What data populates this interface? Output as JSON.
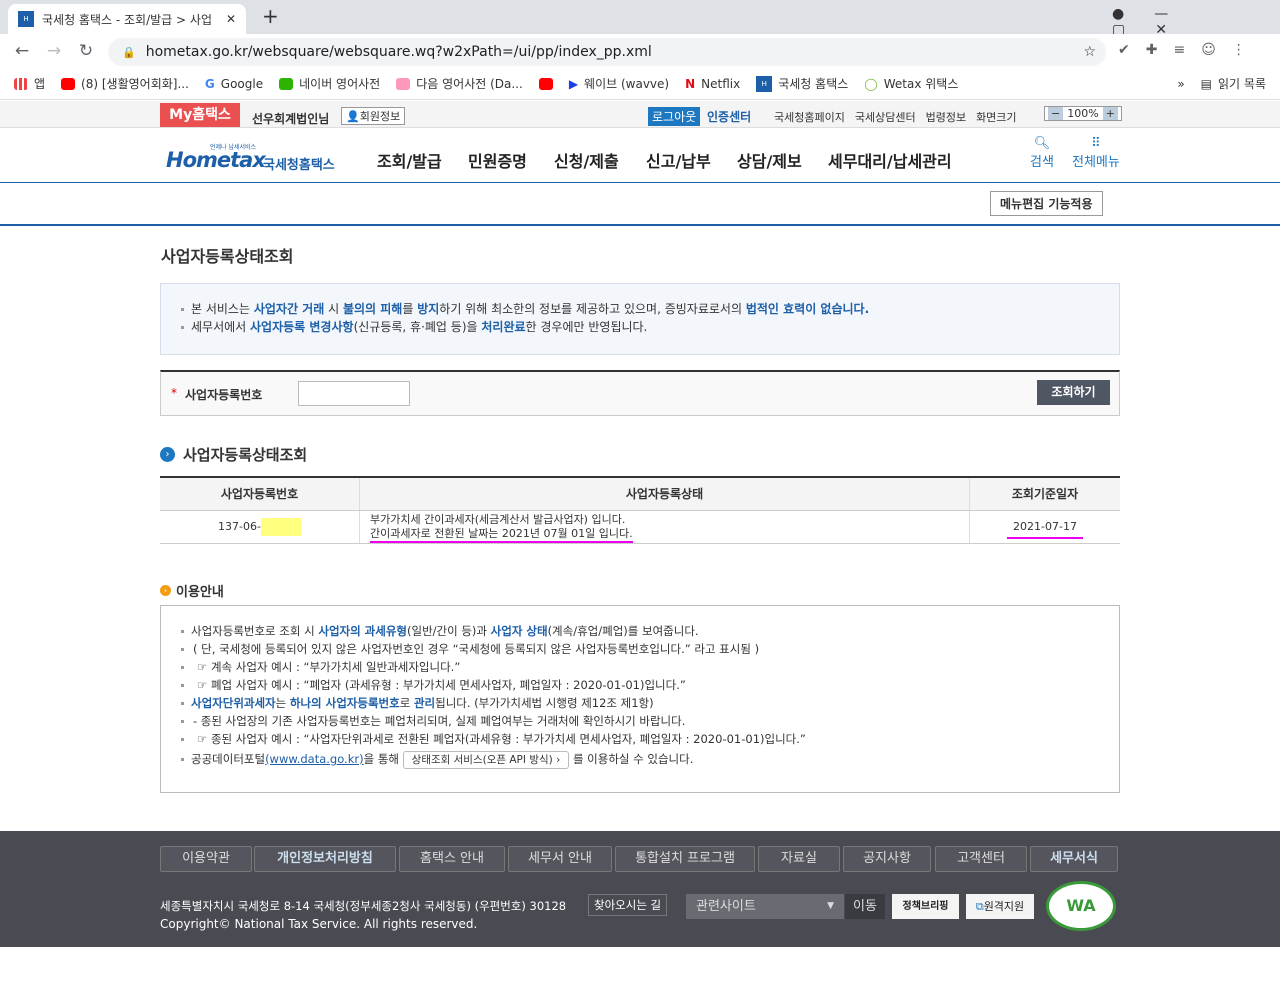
{
  "browser": {
    "tab_title": "국세청 홈택스 - 조회/발급 > 사업",
    "url": "hometax.go.kr/websquare/websquare.wq?w2xPath=/ui/pp/index_pp.xml",
    "bookmarks": [
      "앱",
      "(8) [생활영어회화]...",
      "Google",
      "네이버 영어사전",
      "다음 영어사전 (Da...",
      "",
      "웨이브 (wavve)",
      "Netflix",
      "국세청 홈택스",
      "Wetax 위택스"
    ],
    "more": "»",
    "reading_list": "읽기 목록"
  },
  "topbar": {
    "my": "My홈택스",
    "user": "선우회계법인님",
    "member_info": "회원정보",
    "logout": "로그아웃",
    "cert": "인증센터",
    "links": [
      "국세청홈페이지",
      "국세상담센터",
      "법령정보"
    ],
    "zoom_label": "화면크기",
    "zoom": "100%"
  },
  "nav": {
    "logo": "Hometax",
    "logo_sub": "국세청홈택스",
    "logo_tag": "언제나 납세서비스",
    "menu": [
      "조회/발급",
      "민원증명",
      "신청/제출",
      "신고/납부",
      "상담/제보",
      "세무대리/납세관리"
    ],
    "search": "검색",
    "all_menu": "전체메뉴",
    "edit": "메뉴편집 기능적용"
  },
  "page": {
    "title": "사업자등록상태조회",
    "notice": [
      [
        "본 서비스는 ",
        "사업자간 거래",
        " 시 ",
        "불의의 피해",
        "를 ",
        "방지",
        "하기 위해 최소한의 정보를 제공하고 있으며, 증빙자료로서의 ",
        "법적인 효력이 없습니다."
      ],
      [
        "세무서에서 ",
        "사업자등록 변경사항",
        "(신규등록, 휴·폐업 등)을 ",
        "처리완료",
        "한 경우에만 반영됩니다."
      ]
    ],
    "form": {
      "label": "사업자등록번호",
      "value": "",
      "button": "조회하기"
    },
    "result_title": "사업자등록상태조회",
    "table": {
      "headers": [
        "사업자등록번호",
        "사업자등록상태",
        "조회기준일자"
      ],
      "rows": [
        {
          "number": "137-06-",
          "status1": "부가가치세 간이과세자(세금계산서 발급사업자) 입니다.",
          "status2": "간이과세자로 전환된 날짜는 2021년 07월 01일 입니다.",
          "date": "2021-07-17"
        }
      ]
    },
    "guide_title": "이용안내",
    "guide": {
      "l1": [
        "사업자등록번호로 조회 시 ",
        "사업자의 과세유형",
        "(일반/간이 등)과 ",
        "사업자 상태",
        "(계속/휴업/폐업)를 보여줍니다."
      ],
      "l2": "( 단, 국세청에 등록되어 있지 않은 사업자번호인 경우 “국세청에 등록되지 않은 사업자등록번호입니다.” 라고 표시됨 )",
      "l3": "계속 사업자 예시 : “부가가치세 일반과세자입니다.”",
      "l4": "폐업 사업자 예시 : “폐업자 (과세유형 : 부가가치세 면세사업자, 폐업일자 : 2020-01-01)입니다.”",
      "l5": [
        "사업자단위과세자",
        "는 ",
        "하나의 사업자등록번호",
        "로 ",
        "관리",
        "됩니다. (부가가치세법 시행령 제12조 제1항)"
      ],
      "l6": "- 종된 사업장의 기존 사업자등록번호는 폐업처리되며, 실제 폐업여부는 거래처에 확인하시기 바랍니다.",
      "l7": "종된 사업자 예시 : “사업자단위과세로 전환된 폐업자(과세유형 : 부가가치세 면세사업자, 폐업일자 : 2020-01-01)입니다.”",
      "l8a": "공공데이터포털",
      "l8link": "(www.data.go.kr)",
      "l8b": "을 통해",
      "api_button": "상태조회 서비스(오픈 API 방식) ›",
      "l8c": "를 이용하실 수 있습니다."
    }
  },
  "footer": {
    "links": [
      "이용약관",
      "개인정보처리방침",
      "홈택스 안내",
      "세무서 안내",
      "통합설치 프로그램",
      "자료실",
      "공지사항",
      "고객센터",
      "세무서식"
    ],
    "address": "세종특별자치시 국세청로 8-14 국세청(정부세종2청사 국세청동) (우편번호) 30128",
    "directions": "찾아오시는 길",
    "copyright": "Copyright© National Tax Service. All rights reserved.",
    "related": "관련사이트",
    "go": "이동",
    "policy": "정책브리핑",
    "remote": "원격지원",
    "wa": "WA"
  },
  "colors": {
    "brand": "#1d5fa8",
    "my": "#e9504f"
  }
}
